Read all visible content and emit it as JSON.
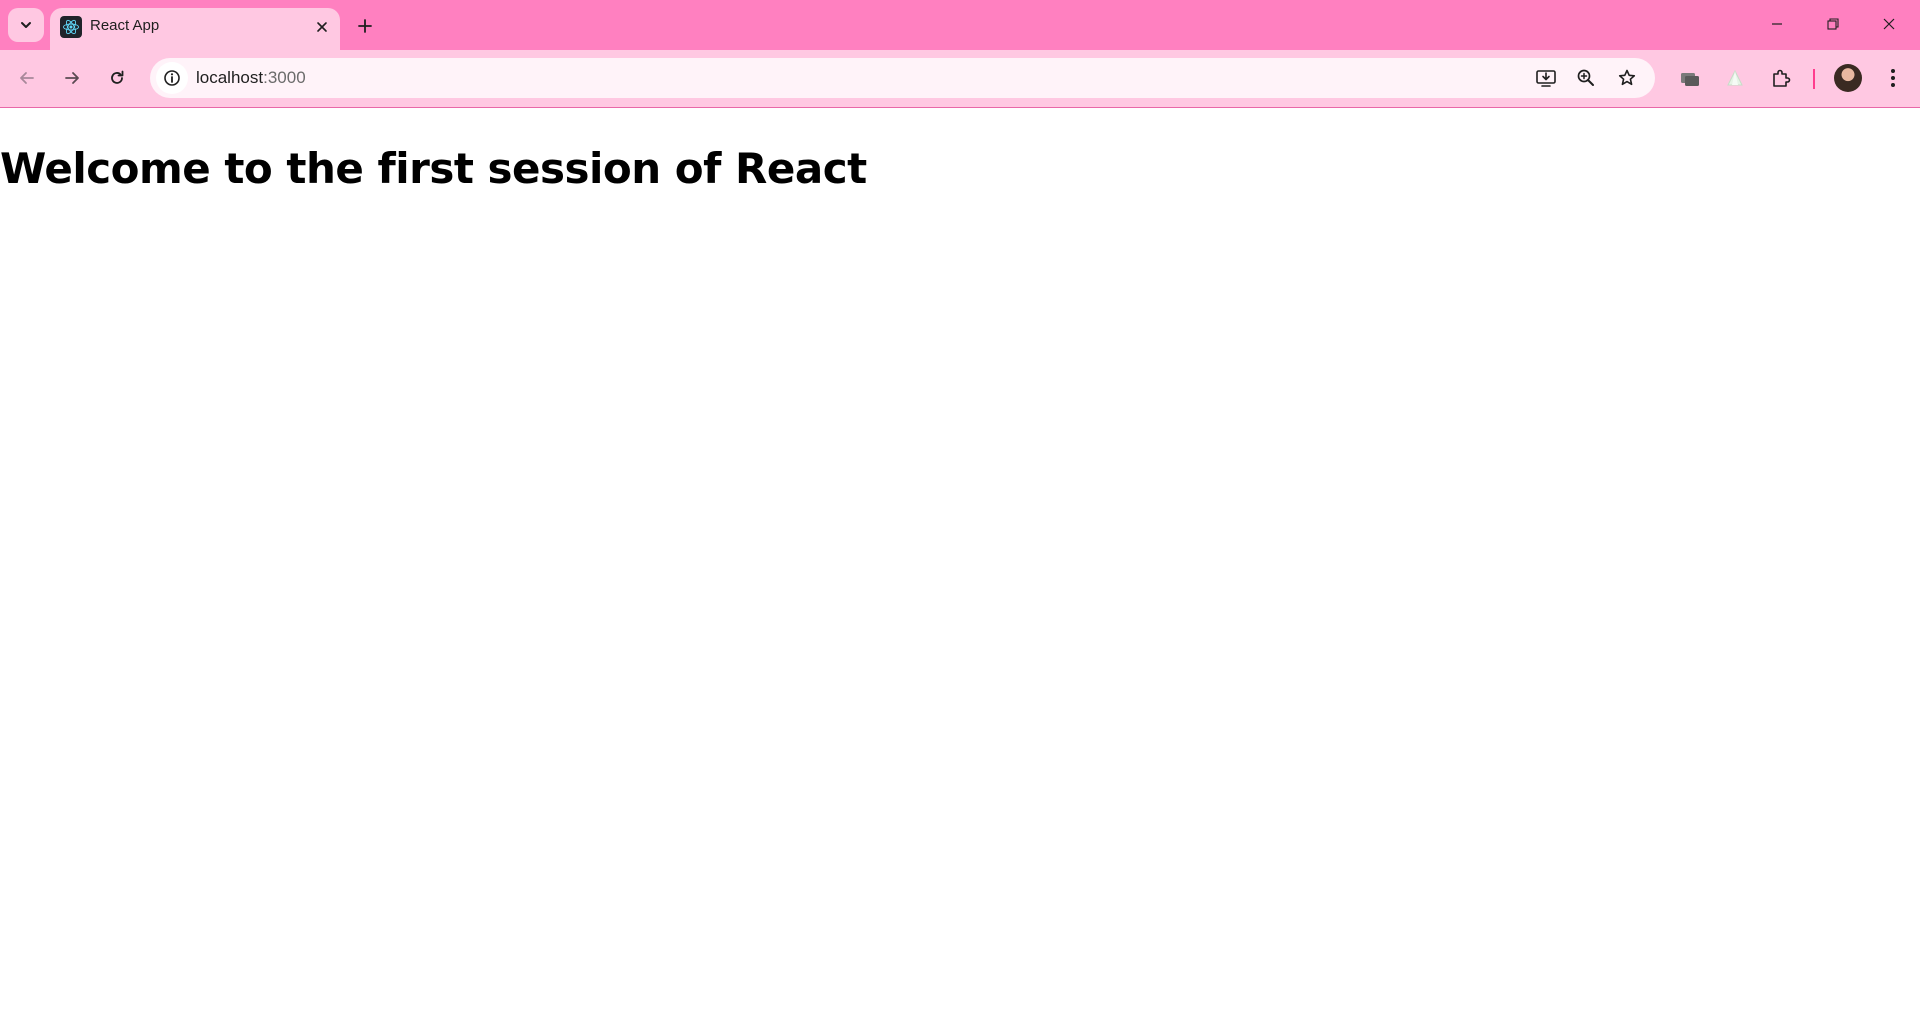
{
  "browser": {
    "tab": {
      "title": "React App",
      "favicon": "react-logo-icon"
    },
    "address_bar": {
      "host": "localhost",
      "port": ":3000"
    },
    "icons": {
      "tab_search": "chevron-down-icon",
      "tab_close": "close-icon",
      "new_tab": "plus-icon",
      "minimize": "minimize-icon",
      "restore": "restore-icon",
      "close_window": "close-icon",
      "back": "arrow-left-icon",
      "forward": "arrow-right-icon",
      "reload": "reload-icon",
      "site_info": "info-icon",
      "install": "install-app-icon",
      "zoom": "zoom-in-icon",
      "bookmark": "star-icon",
      "extension_1": "extension-cards-icon",
      "extension_2": "extension-triangle-icon",
      "extensions": "puzzle-icon",
      "profile": "avatar",
      "menu": "kebab-menu-icon"
    },
    "colors": {
      "tabstrip": "#ff80c0",
      "toolbar": "#ffc8e2",
      "omnibox": "#fff3f9",
      "react_blue": "#61dafb"
    }
  },
  "page": {
    "heading": "Welcome to the first session of React"
  }
}
